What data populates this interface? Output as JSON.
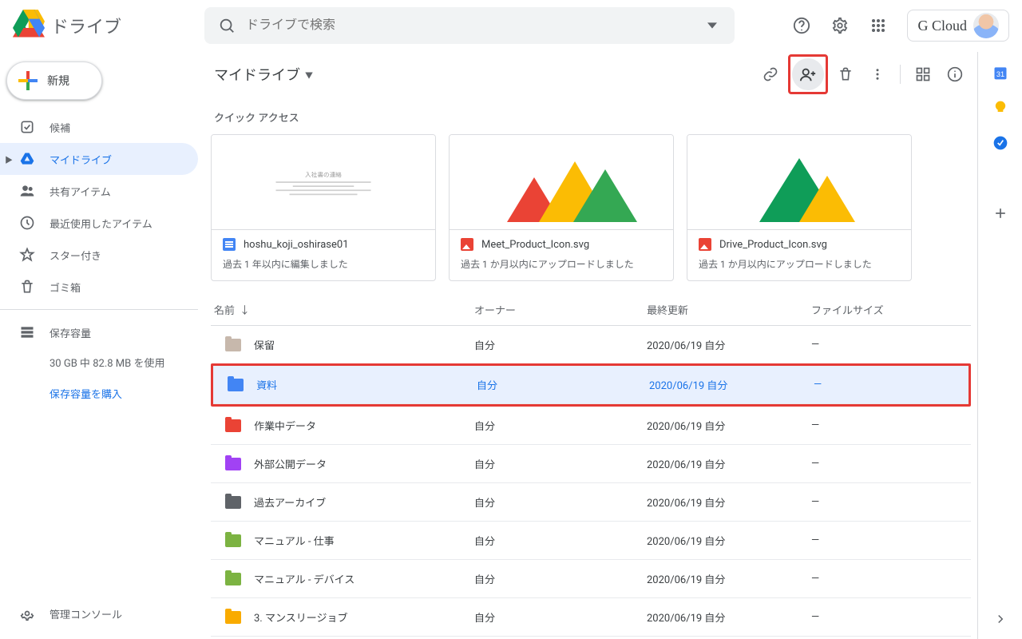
{
  "header": {
    "app_name": "ドライブ",
    "search_placeholder": "ドライブで検索",
    "brand_name": "G Cloud"
  },
  "sidebar": {
    "new_label": "新規",
    "items": [
      {
        "label": "候補",
        "icon": "priority"
      },
      {
        "label": "マイドライブ",
        "icon": "mydrive",
        "active": true,
        "expander": true
      },
      {
        "label": "共有アイテム",
        "icon": "shared"
      },
      {
        "label": "最近使用したアイテム",
        "icon": "recent"
      },
      {
        "label": "スター付き",
        "icon": "star"
      },
      {
        "label": "ゴミ箱",
        "icon": "trash"
      }
    ],
    "storage_label": "保存容量",
    "storage_used": "30 GB 中 82.8 MB を使用",
    "buy_storage": "保存容量を購入",
    "admin_label": "管理コンソール"
  },
  "main": {
    "breadcrumb": "マイドライブ",
    "quick_access_label": "クイック アクセス",
    "quick_access": [
      {
        "title": "hoshu_koji_oshirase01",
        "subtitle": "過去 1 年以内に編集しました",
        "kind": "doc"
      },
      {
        "title": "Meet_Product_Icon.svg",
        "subtitle": "過去 1 か月以内にアップロードしました",
        "kind": "img"
      },
      {
        "title": "Drive_Product_Icon.svg",
        "subtitle": "過去 1 か月以内にアップロードしました",
        "kind": "img"
      }
    ],
    "columns": {
      "name": "名前",
      "owner": "オーナー",
      "modified": "最終更新",
      "size": "ファイルサイズ"
    },
    "sort_arrow": "↓",
    "rows": [
      {
        "name": "保留",
        "owner": "自分",
        "modified": "2020/06/19 自分",
        "size": "—",
        "color": "#c7b8ac"
      },
      {
        "name": "資料",
        "owner": "自分",
        "modified": "2020/06/19 自分",
        "size": "—",
        "color": "#4285f4",
        "selected": true,
        "highlight": true
      },
      {
        "name": "作業中データ",
        "owner": "自分",
        "modified": "2020/06/19 自分",
        "size": "—",
        "color": "#ea4335"
      },
      {
        "name": "外部公開データ",
        "owner": "自分",
        "modified": "2020/06/19 自分",
        "size": "—",
        "color": "#a142f4"
      },
      {
        "name": "過去アーカイブ",
        "owner": "自分",
        "modified": "2020/06/19 自分",
        "size": "—",
        "color": "#5f6368"
      },
      {
        "name": "マニュアル - 仕事",
        "owner": "自分",
        "modified": "2020/06/19 自分",
        "size": "—",
        "color": "#7cb342"
      },
      {
        "name": "マニュアル - デバイス",
        "owner": "自分",
        "modified": "2020/06/19 自分",
        "size": "—",
        "color": "#7cb342"
      },
      {
        "name": "3. マンスリージョブ",
        "owner": "自分",
        "modified": "2020/06/19 自分",
        "size": "—",
        "color": "#f9ab00"
      }
    ]
  }
}
